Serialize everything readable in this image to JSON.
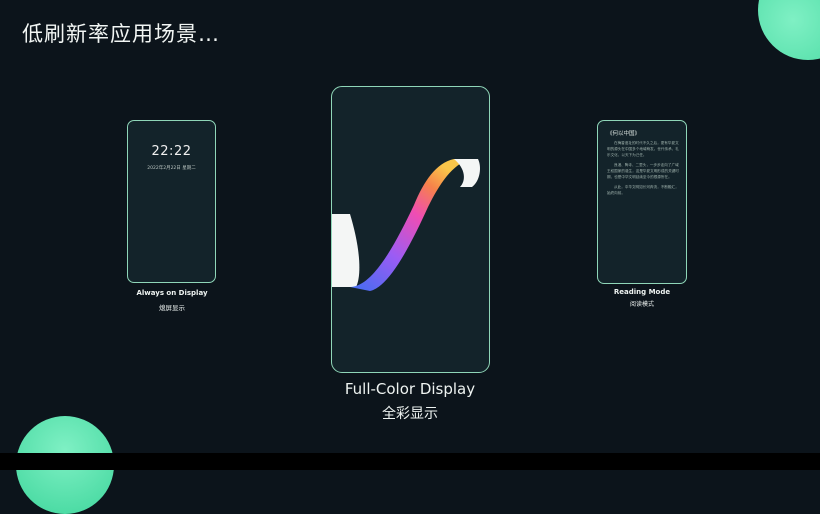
{
  "slide": {
    "title": "低刷新率应用场景…"
  },
  "always_on": {
    "time": "22:22",
    "date": "2022年2月22日 星期二",
    "label_en": "Always on Display",
    "label_cn": "熄屏显示"
  },
  "full_color": {
    "label_en": "Full-Color Display",
    "label_cn": "全彩显示"
  },
  "reading": {
    "title": "《何以中国》",
    "paragraphs": [
      "在梅香遗址的时代不久之后，更有华夏文明的源头在中国多个地域萌发。世代传承，礼乐文化，以天下为己任。",
      "良渚、陶寺、二里头，一步步走向了广域王权国家的诞生，这是华夏文明形成的关键时期，也是中华文明延续至今的根源所在。",
      "从此，中华文明如长河奔流，不断融汇，始终向前。"
    ],
    "label_en": "Reading Mode",
    "label_cn": "阅读模式"
  },
  "colors": {
    "background": "#0c141b",
    "accent": "#4fe0a8",
    "phone_border": "#8fd6b8"
  }
}
